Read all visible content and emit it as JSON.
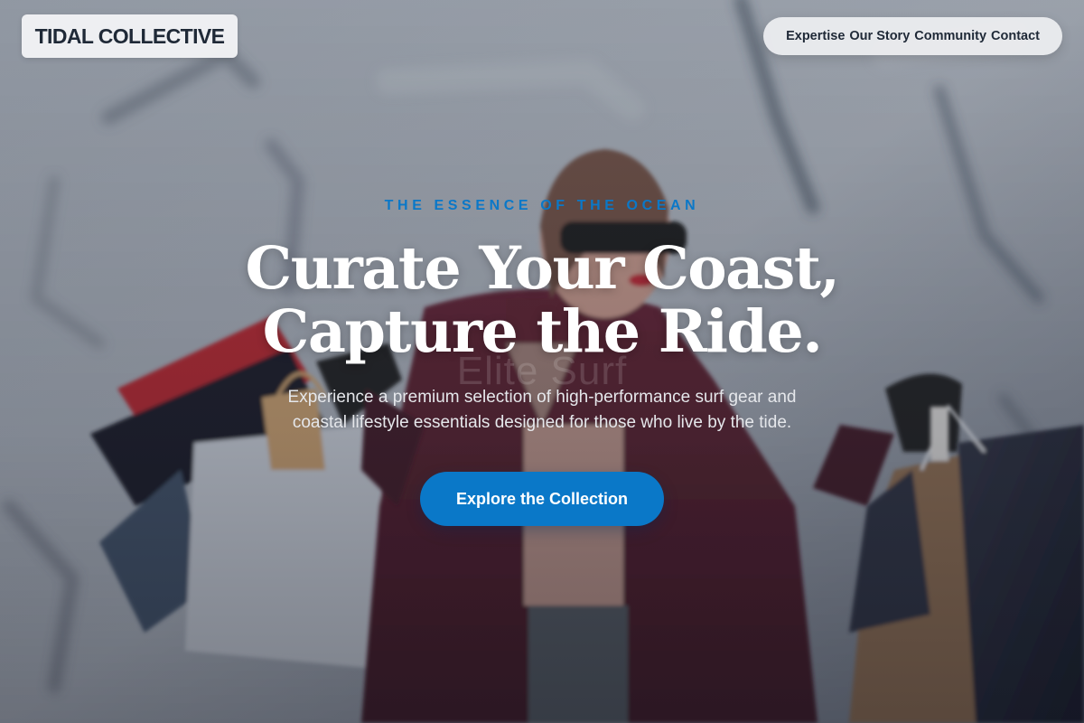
{
  "header": {
    "logo_text": "TIDAL COLLECTIVE",
    "nav": [
      {
        "label": "Expertise"
      },
      {
        "label": "Our Story"
      },
      {
        "label": "Community"
      },
      {
        "label": "Contact"
      }
    ]
  },
  "hero": {
    "eyebrow": "THE ESSENCE OF THE OCEAN",
    "headline_line1": "Curate Your Coast,",
    "headline_line2": "Capture the Ride.",
    "description_line1": "Experience a premium selection of high-performance surf gear and",
    "description_line2": "coastal lifestyle essentials designed for those who live by the tide.",
    "cta_label": "Explore the Collection",
    "background_watermark": "Elite Surf"
  },
  "colors": {
    "accent": "#0a78c8",
    "header_bg": "#f3f4f6",
    "text_dark": "#1f2937",
    "headline": "#ffffff"
  },
  "background_image": "photo of a woman in sunglasses and a burgundy coat holding shopping bags, behind a dark overlay"
}
